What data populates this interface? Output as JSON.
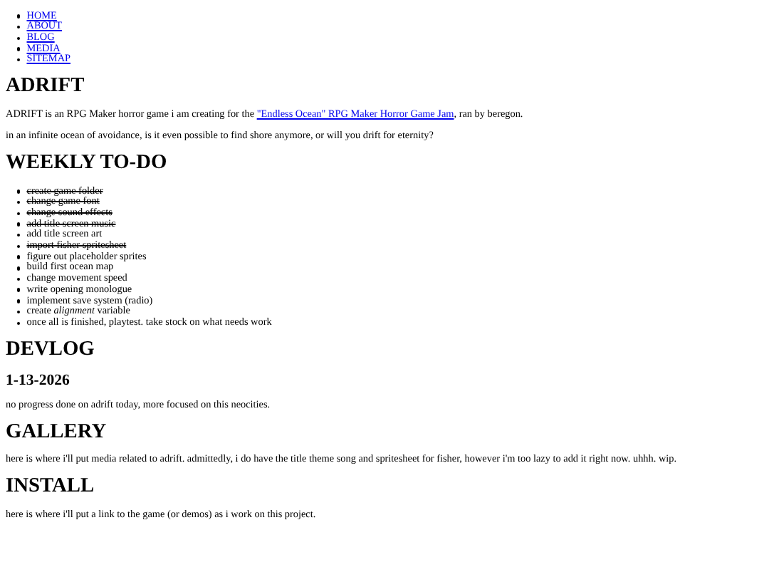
{
  "nav": [
    {
      "label": "HOME"
    },
    {
      "label": "ABOUT"
    },
    {
      "label": "BLOG"
    },
    {
      "label": "MEDIA"
    },
    {
      "label": "SITEMAP"
    }
  ],
  "about": {
    "title": "ADRIFT",
    "intro": {
      "before": "ADRIFT is an RPG Maker horror game i am creating for the ",
      "link": "\"Endless Ocean\" RPG Maker Horror Game Jam",
      "after": ", ran by beregon."
    },
    "tagline": "in an infinite ocean of avoidance, is it even possible to find shore anymore, or will you drift for eternity?"
  },
  "todo": {
    "title": "WEEKLY TO-DO",
    "items": [
      {
        "text": "create game folder",
        "done": true
      },
      {
        "text": "change game font",
        "done": true
      },
      {
        "text": "change sound effects",
        "done": true
      },
      {
        "text": "add title screen music",
        "done": true
      },
      {
        "text": "add title screen art",
        "done": false
      },
      {
        "text": "import fisher spritesheet",
        "done": true
      },
      {
        "text": "figure out placeholder sprites",
        "done": false
      },
      {
        "text": "build first ocean map",
        "done": false
      },
      {
        "text": "change movement speed",
        "done": false
      },
      {
        "text": "write opening monologue",
        "done": false
      },
      {
        "text": "implement save system (radio)",
        "done": false
      },
      {
        "text": "create *alignment* variable",
        "done": false
      },
      {
        "text": "once all is finished, playtest. take stock on what needs work",
        "done": false
      }
    ]
  },
  "devlog": {
    "title": "DEVLOG",
    "entries": [
      {
        "date": "1-13-2026",
        "text": "no progress done on adrift today, more focused on this neocities."
      }
    ]
  },
  "gallery": {
    "title": "GALLERY",
    "text": "here is where i'll put media related to adrift. admittedly, i do have the title theme song and spritesheet for fisher, however i'm too lazy to add it right now. uhhh. wip."
  },
  "install": {
    "title": "INSTALL",
    "text": "here is where i'll put a link to the game (or demos) as i work on this project."
  }
}
